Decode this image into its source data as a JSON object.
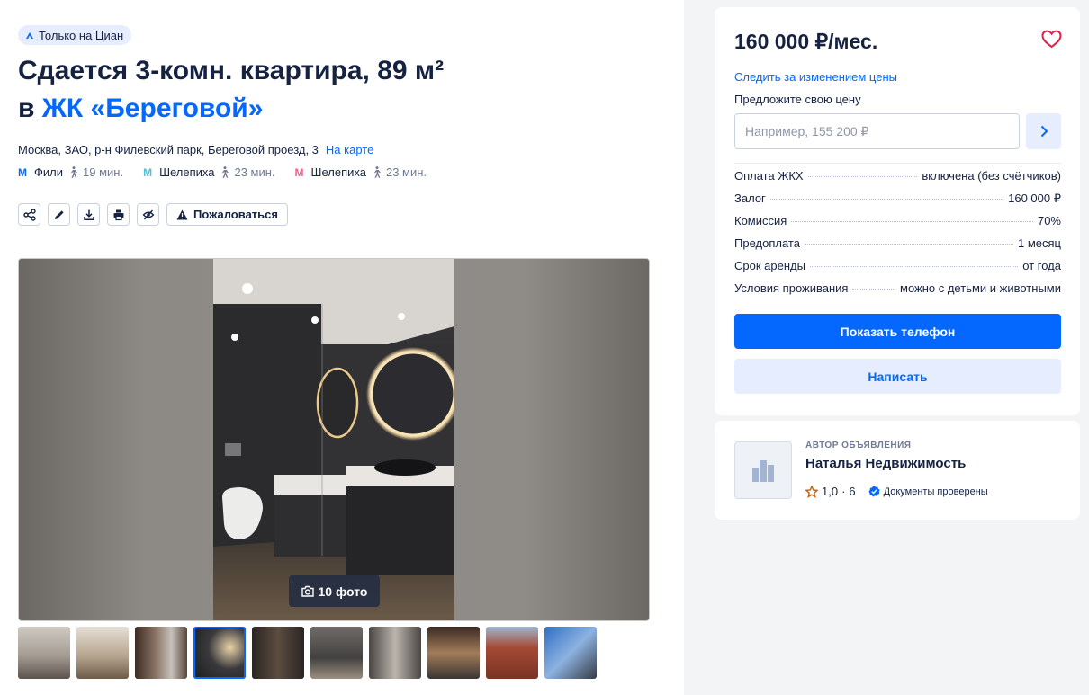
{
  "badge": {
    "label": "Только на Циан",
    "icon": "cian-logo-icon"
  },
  "title": {
    "line1": "Сдается 3-комн. квартира, 89 м²",
    "prefix": "в",
    "complex": "ЖК «Береговой»"
  },
  "address": {
    "text": "Москва, ЗАО, р-н Филевский парк, Береговой проезд, 3",
    "map_link": "На карте"
  },
  "metro": [
    {
      "name": "Фили",
      "color": "#0a6cff",
      "time": "19 мин."
    },
    {
      "name": "Шелепиха",
      "color": "#4cc3d9",
      "time": "23 мин."
    },
    {
      "name": "Шелепиха",
      "color": "#f25e8a",
      "time": "23 мин."
    }
  ],
  "toolbar": {
    "icons": [
      "share-icon",
      "edit-icon",
      "download-icon",
      "print-icon",
      "hide-icon"
    ],
    "complain_label": "Пожаловаться"
  },
  "gallery": {
    "photo_count": "10 фото",
    "active_thumb": 4,
    "thumb_count": 10
  },
  "card": {
    "price": "160 000 ₽/мес.",
    "track_price": "Следить за изменением цены",
    "offer_label": "Предложите свою цену",
    "offer_placeholder": "Например, 155 200 ₽",
    "terms": [
      {
        "label": "Оплата ЖКХ",
        "value": "включена (без счётчиков)"
      },
      {
        "label": "Залог",
        "value": "160 000 ₽"
      },
      {
        "label": "Комиссия",
        "value": "70%"
      },
      {
        "label": "Предоплата",
        "value": "1 месяц"
      },
      {
        "label": "Срок аренды",
        "value": "от года"
      },
      {
        "label": "Условия проживания",
        "value": "можно с детьми и животными"
      }
    ],
    "phone_button": "Показать телефон",
    "write_button": "Написать"
  },
  "author": {
    "caption": "АВТОР ОБЪЯВЛЕНИЯ",
    "name": "Наталья Недвижимость",
    "rating": "1,0",
    "separator": "·",
    "reviews": "6",
    "docs": "Документы проверены"
  },
  "colors": {
    "accent": "#0468ff",
    "accent_light": "#e5edff",
    "text": "#152242",
    "heart": "#d9224a"
  }
}
